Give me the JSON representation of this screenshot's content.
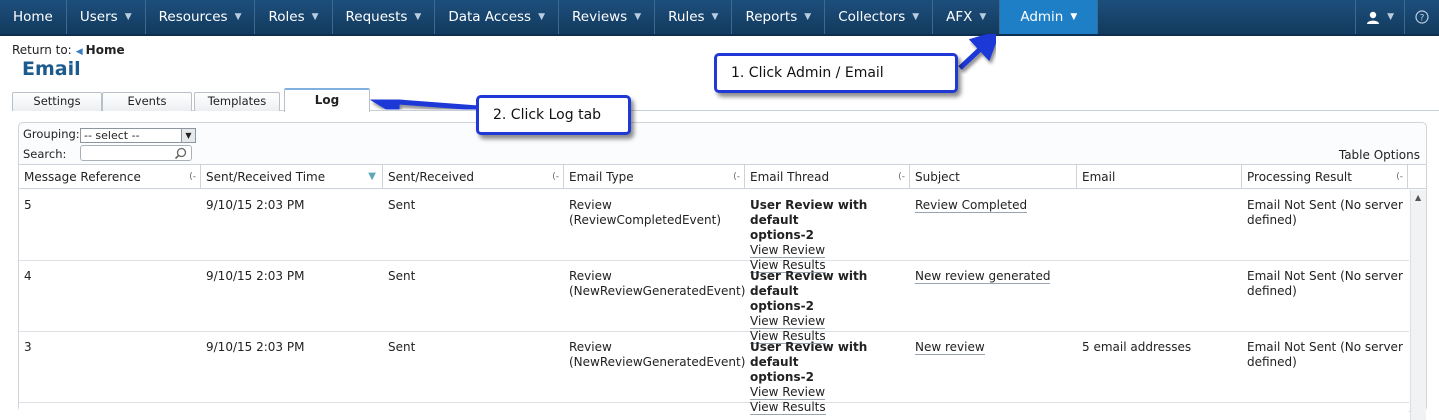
{
  "nav": {
    "items": [
      {
        "label": "Home",
        "has_caret": false
      },
      {
        "label": "Users",
        "has_caret": true
      },
      {
        "label": "Resources",
        "has_caret": true
      },
      {
        "label": "Roles",
        "has_caret": true
      },
      {
        "label": "Requests",
        "has_caret": true
      },
      {
        "label": "Data Access",
        "has_caret": true
      },
      {
        "label": "Reviews",
        "has_caret": true
      },
      {
        "label": "Rules",
        "has_caret": true
      },
      {
        "label": "Reports",
        "has_caret": true
      },
      {
        "label": "Collectors",
        "has_caret": true
      },
      {
        "label": "AFX",
        "has_caret": true
      },
      {
        "label": "Admin",
        "has_caret": true,
        "active": true
      }
    ],
    "caret": "▼",
    "user_icon": "user-icon",
    "help_icon": "help-icon",
    "active_color": "#1e7fc7",
    "bar_color": "#1d4f7c"
  },
  "header": {
    "return_to_label": "Return to:",
    "return_to_link": "Home",
    "title": "Email"
  },
  "tabs": [
    {
      "label": "Settings"
    },
    {
      "label": "Events"
    },
    {
      "label": "Templates"
    },
    {
      "label": "Log",
      "active": true
    }
  ],
  "controls": {
    "grouping_label": "Grouping:",
    "grouping_value": "-- select --",
    "search_label": "Search:",
    "search_value": "",
    "table_options": "Table Options"
  },
  "table": {
    "columns": [
      "Message Reference",
      "Sent/Received Time",
      "Sent/Received",
      "Email Type",
      "Email Thread",
      "Subject",
      "Email",
      "Processing Result"
    ],
    "rows": [
      {
        "ref": "5",
        "time": "9/10/15 2:03 PM",
        "sent_received": "Sent",
        "email_type_line1": "Review",
        "email_type_line2": "(ReviewCompletedEvent)",
        "thread_title_line1": "User Review with default",
        "thread_title_line2": "options-2",
        "thread_link1": "View Review",
        "thread_link2": "View Results",
        "subject": "Review Completed",
        "email": "",
        "result_line1": "Email Not Sent (No server",
        "result_line2": "defined)"
      },
      {
        "ref": "4",
        "time": "9/10/15 2:03 PM",
        "sent_received": "Sent",
        "email_type_line1": "Review",
        "email_type_line2": "(NewReviewGeneratedEvent)",
        "thread_title_line1": "User Review with default",
        "thread_title_line2": "options-2",
        "thread_link1": "View Review",
        "thread_link2": "View Results",
        "subject": "New review generated",
        "email": "",
        "result_line1": "Email Not Sent (No server",
        "result_line2": "defined)"
      },
      {
        "ref": "3",
        "time": "9/10/15 2:03 PM",
        "sent_received": "Sent",
        "email_type_line1": "Review",
        "email_type_line2": "(NewReviewGeneratedEvent)",
        "thread_title_line1": "User Review with default",
        "thread_title_line2": "options-2",
        "thread_link1": "View Review",
        "thread_link2": "View Results",
        "subject": "New review",
        "email": "5 email addresses",
        "result_line1": "Email Not Sent (No server",
        "result_line2": "defined)"
      }
    ]
  },
  "callouts": {
    "step1": "1. Click Admin / Email",
    "step2": "2. Click Log tab",
    "color": "#1f38d6"
  }
}
